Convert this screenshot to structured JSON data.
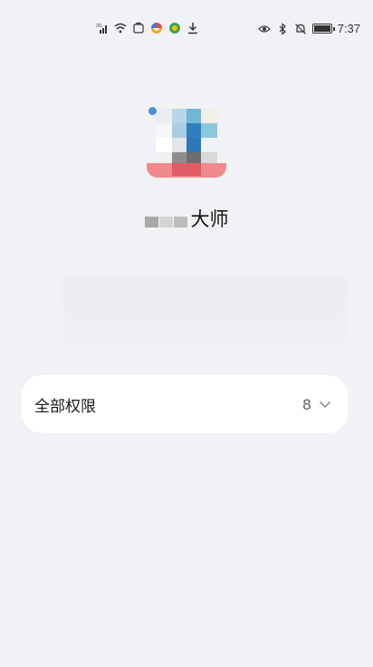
{
  "status_bar": {
    "network_label": "2G",
    "time": "7:37"
  },
  "app": {
    "name_suffix": "大师"
  },
  "permissions": {
    "label": "全部权限",
    "count": "8"
  },
  "colors": {
    "background": "#f1f2f5",
    "card": "#ffffff",
    "muted_text": "#666666"
  }
}
